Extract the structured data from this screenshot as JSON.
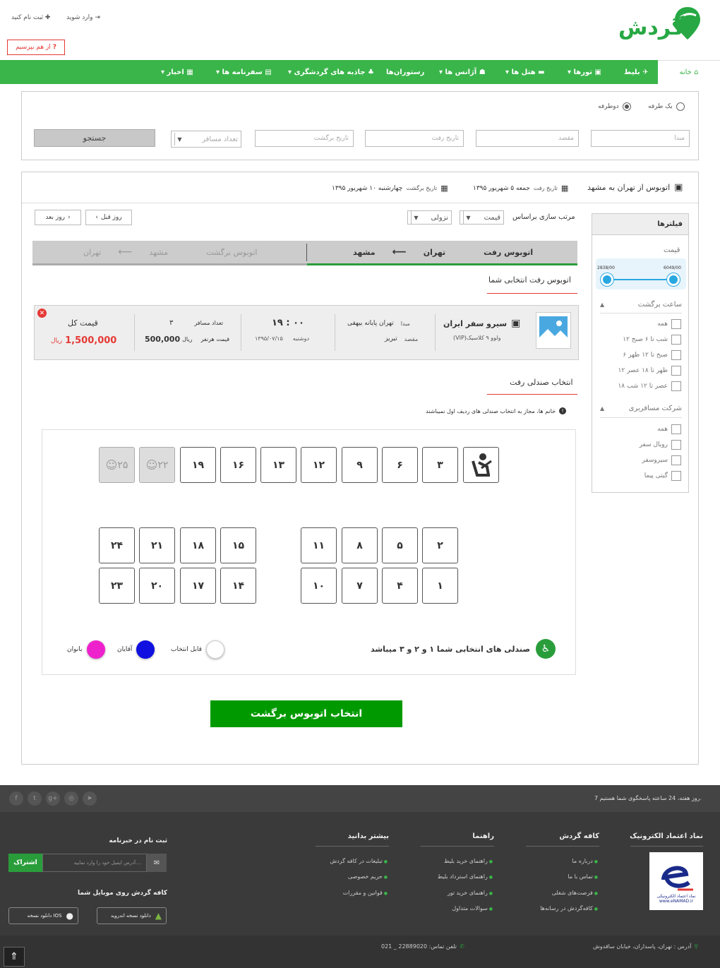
{
  "header": {
    "logo": "گردش",
    "login": "وارد شوید",
    "register": "ثبت نام کنید",
    "ask": "از هم بپرسیم",
    "ask_mark": "?"
  },
  "nav": {
    "home": "خانه",
    "ticket": "بلیط",
    "tours": "تورها",
    "hotels": "هتل ها",
    "agencies": "آژانس ها",
    "restaurants": "رستوران‌ها",
    "attractions": "جاذبه های گردشگری",
    "travelogue": "سفرنامه ها",
    "news": "اخبار",
    "caret": "▾"
  },
  "search": {
    "one_way": "یک طرفه",
    "round_trip": "دوطرفه",
    "origin": "مبدا",
    "destination": "مقصد",
    "depart_date": "تاریخ رفت",
    "return_date": "تاریخ برگشت",
    "passengers": "تعداد مسافر",
    "button": "جستجو"
  },
  "trip": {
    "title": "اتوبوس از تهران به مشهد",
    "depart_label": "تاریخ رفت",
    "depart_value": "جمعه ۵ شهریور ۱۳۹۵",
    "return_label": "تاریخ برگشت",
    "return_value": "چهارشنبه ۱۰ شهریور ۱۳۹۵",
    "sort_label": "مرتب سازی براساس",
    "sort_value": "قیمت",
    "order_value": "نزولی",
    "prev_day": "روز قبل",
    "next_day": "روز بعد"
  },
  "tabs": {
    "depart_label": "اتوبوس رفت",
    "depart_from": "تهران",
    "depart_to": "مشهد",
    "return_label": "اتوبوس برگشت",
    "return_from": "تهران",
    "return_to": "مشهد"
  },
  "selected": {
    "heading": "اتوبوس رفت انتخابی شما",
    "company": "سیرو سفر ایران",
    "bus_type": "(VIP)ولوو ۹ کلاسیک",
    "origin_label": "مبدا",
    "origin_value": "تهران پایانه بیهقی",
    "dest_label": "مقصد",
    "dest_value": "تبریز",
    "time": "۱۹ : ۰۰",
    "day": "دوشنبه",
    "date": "۱۳۹۵/۰۷/۱۵",
    "passengers_label": "تعداد مسافر",
    "passengers_value": "۳",
    "unit_price_label": "قیمت هرنفر",
    "unit_price_value": "500,000",
    "currency": "ریال",
    "total_label": "قیمت کل",
    "total_value": "1,500,000"
  },
  "seats": {
    "heading": "انتخاب صندلی رفت",
    "notice": "خانم ها، مجاز به انتخاب صندلی های ردیف اول نمیباشند",
    "notice_icon": "!",
    "row1": [
      "۳",
      "۶",
      "۹",
      "۱۲",
      "۱۳",
      "۱۶",
      "۱۹"
    ],
    "taken": [
      "۲۲",
      "۲۵"
    ],
    "row2_right": [
      "۲",
      "۵",
      "۸",
      "۱۱"
    ],
    "row2_left": [
      "۱۵",
      "۱۸",
      "۲۱",
      "۲۴"
    ],
    "row3_right": [
      "۱",
      "۴",
      "۷",
      "۱۰"
    ],
    "row3_left": [
      "۱۴",
      "۱۷",
      "۲۰",
      "۲۳"
    ],
    "selected_msg": "صندلی های انتخابی شما ۱ و ۲ و ۳ میباشد",
    "legend_available": "قابل انتخاب",
    "legend_men": "آقایان",
    "legend_women": "بانوان",
    "next_button": "انتخاب اتوبوس برگشت"
  },
  "filters": {
    "title": "فیلترها",
    "price": "قیمت",
    "price_min": "2838/00",
    "price_max": "6049/00",
    "time_title": "ساعت برگشت",
    "time_options": [
      "همه",
      "شب تا ۶ صبح ۱۲",
      "صبح تا ۱۲ ظهر ۶",
      "ظهر تا ۱۸ عصر ۱۲",
      "عصر تا ۱۲ شب ۱۸"
    ],
    "company_title": "شرکت مسافربری",
    "company_options": [
      "همه",
      "رویال سفر",
      "سیروسفر",
      "گیتی پیما"
    ]
  },
  "footer": {
    "support": "7 روز هفته، 24 ساعته پاسخگوی شما هستیم.",
    "enamad_title": "نماد اعتماد الکترونیک",
    "enamad_caption": "نماد اعتماد الکترونیکی",
    "enamad_url": "www.eNAMAD.ir",
    "cafe_title": "کافه گردش",
    "cafe_links": [
      "درباره ما",
      "تماس با ما",
      "فرصت‌های شغلی",
      "کافه‌گردش در رسانه‌ها"
    ],
    "guide_title": "راهنما",
    "guide_links": [
      "راهنمای خرید بلیط",
      "راهنمای استرداد بلیط",
      "راهنمای خرید تور",
      "سوالات متداول"
    ],
    "more_title": "بیشتر بدانید",
    "more_links": [
      "تبلیغات در کافه گردش",
      "حریم خصوصی",
      "قوانین و مقررات"
    ],
    "newsletter_title": "ثبت نام در خبرنامه",
    "newsletter_placeholder": "آدرس ایمیل خود را وارد نمایید....",
    "subscribe": "اشتراک",
    "mobile_title": "کافه گردش روی موبایل شما",
    "android": "دانلود نسخه اندروید",
    "ios": "دانلود نسخه IOS",
    "address": "آدرس : تهران، پاسداران، خیابان ساقدوش",
    "phone": "تلفن تماس: 22889020 _ 021"
  }
}
